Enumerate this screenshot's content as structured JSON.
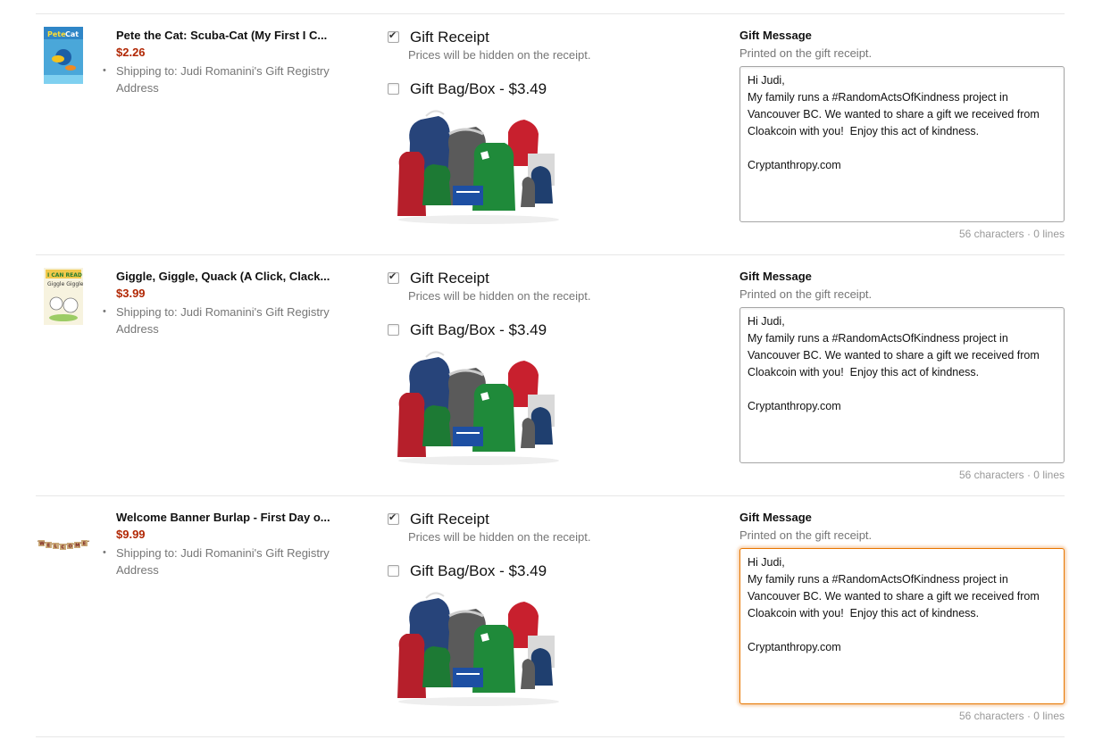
{
  "items": [
    {
      "title": "Pete the Cat: Scuba-Cat (My First I C...",
      "price": "$2.26",
      "shipping": "Shipping to:  Judi Romanini's Gift Registry Address",
      "thumbnail": "book-cover-pete-the-cat",
      "gift_receipt_label": "Gift Receipt",
      "gift_receipt_checked": true,
      "gift_receipt_note": "Prices will be hidden on the receipt.",
      "gift_bag_label": "Gift Bag/Box - $3.49",
      "gift_bag_checked": false,
      "gift_message_title": "Gift Message",
      "gift_message_sub": "Printed on the gift receipt.",
      "gift_message_text": "Hi Judi,\nMy family runs a #RandomActsOfKindness project in Vancouver BC. We wanted to share a gift we received from Cloakcoin with you!  Enjoy this act of kindness.\n\nCryptanthropy.com",
      "char_count": "56 characters · 0 lines",
      "focused": false
    },
    {
      "title": "Giggle, Giggle, Quack (A Click, Clack...",
      "price": "$3.99",
      "shipping": "Shipping to:  Judi Romanini's Gift Registry Address",
      "thumbnail": "book-cover-giggle-giggle-quack",
      "gift_receipt_label": "Gift Receipt",
      "gift_receipt_checked": true,
      "gift_receipt_note": "Prices will be hidden on the receipt.",
      "gift_bag_label": "Gift Bag/Box - $3.49",
      "gift_bag_checked": false,
      "gift_message_title": "Gift Message",
      "gift_message_sub": "Printed on the gift receipt.",
      "gift_message_text": "Hi Judi,\nMy family runs a #RandomActsOfKindness project in Vancouver BC. We wanted to share a gift we received from Cloakcoin with you!  Enjoy this act of kindness.\n\nCryptanthropy.com",
      "char_count": "56 characters · 0 lines",
      "focused": false
    },
    {
      "title": "Welcome Banner Burlap - First Day o...",
      "price": "$9.99",
      "shipping": "Shipping to:  Judi Romanini's Gift Registry Address",
      "thumbnail": "welcome-banner-image",
      "gift_receipt_label": "Gift Receipt",
      "gift_receipt_checked": true,
      "gift_receipt_note": "Prices will be hidden on the receipt.",
      "gift_bag_label": "Gift Bag/Box - $3.49",
      "gift_bag_checked": false,
      "gift_message_title": "Gift Message",
      "gift_message_sub": "Printed on the gift receipt.",
      "gift_message_text": "Hi Judi,\nMy family runs a #RandomActsOfKindness project in Vancouver BC. We wanted to share a gift we received from Cloakcoin with you!  Enjoy this act of kindness.\n\nCryptanthropy.com",
      "char_count": "56 characters · 0 lines",
      "focused": true
    }
  ],
  "colors": {
    "price": "#b12704",
    "muted": "#767676",
    "focus": "#e77600"
  }
}
